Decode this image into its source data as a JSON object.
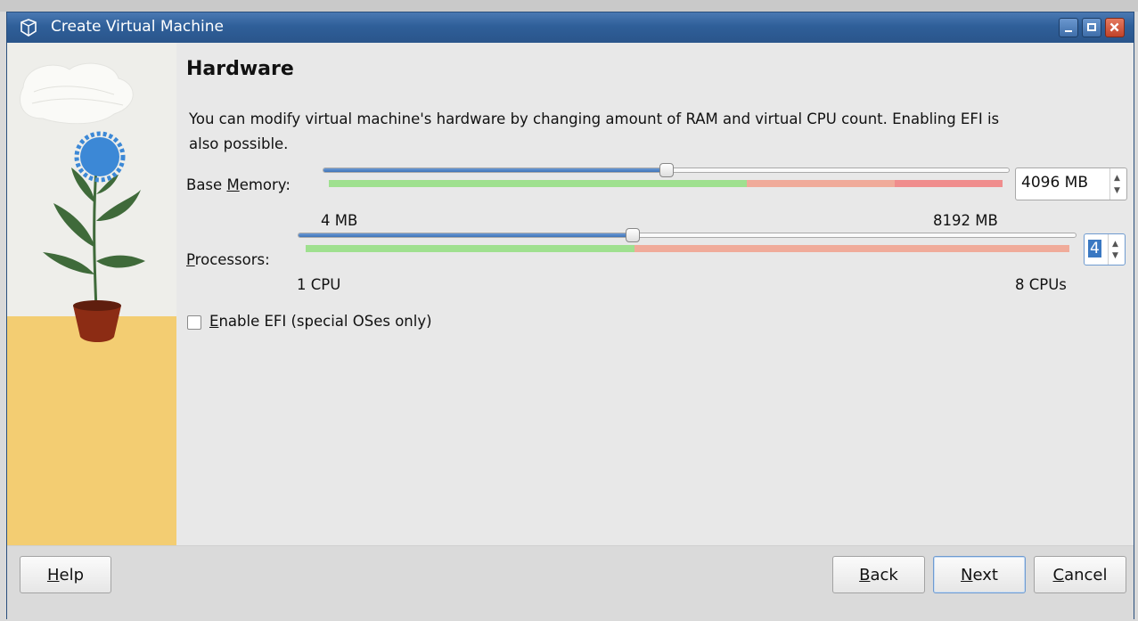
{
  "window": {
    "title": "Create Virtual Machine",
    "controls": [
      "minimize",
      "maximize",
      "close"
    ]
  },
  "page": {
    "heading": "Hardware",
    "description": "You can modify virtual machine's hardware by changing amount of RAM and virtual CPU count. Enabling EFI is also possible."
  },
  "memory": {
    "label_pre": "Base ",
    "label_mnemonic": "M",
    "label_post": "emory:",
    "value": "4096 MB",
    "min_label": "4 MB",
    "max_label": "8192 MB",
    "level": 0.5
  },
  "processors": {
    "label_mnemonic": "P",
    "label_post": "rocessors:",
    "value": "4",
    "min_label": "1 CPU",
    "max_label": "8 CPUs",
    "level": 0.43
  },
  "efi": {
    "label_mnemonic": "E",
    "label_post": "nable EFI (special OSes only)",
    "checked": false
  },
  "buttons": {
    "help_mnemonic": "H",
    "help_post": "elp",
    "back_mnemonic": "B",
    "back_post": "ack",
    "next_mnemonic": "N",
    "next_post": "ext",
    "cancel_mnemonic": "C",
    "cancel_post": "ancel"
  },
  "colors": {
    "titlebar": "#2f5f99",
    "slider_fill": "#3e73b7",
    "meter_good": "#9fe08f",
    "meter_warn": "#f0ab9a",
    "meter_bad": "#f08d8d"
  }
}
